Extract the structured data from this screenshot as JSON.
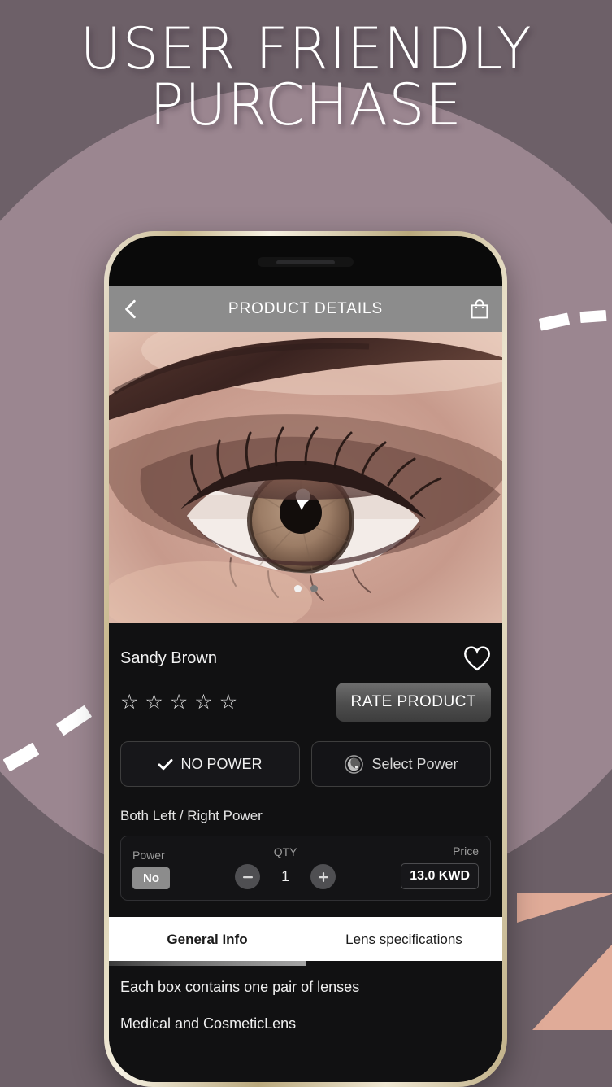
{
  "headline": {
    "line1": "USER FRIENDLY",
    "line2": "PURCHASE"
  },
  "colors": {
    "background": "#6d6068",
    "circle": "#9b8690",
    "triangle": "#e0ab98",
    "appbar": "#8c8c8c",
    "screen": "#111112",
    "pill": "#8c8c8c"
  },
  "phone": {
    "appbar": {
      "title": "PRODUCT DETAILS",
      "back_icon": "chevron-left-icon",
      "cart_icon": "shopping-bag-icon"
    },
    "carousel": {
      "dots": 2,
      "active_index": 0,
      "image_alt": "Close-up of eye wearing sandy brown contact lens"
    },
    "product": {
      "name": "Sandy Brown",
      "favorite_icon": "heart-outline-icon",
      "rating": 0,
      "stars_total": 5,
      "rate_button": "RATE PRODUCT"
    },
    "power_options": [
      {
        "label": "NO POWER",
        "icon": "check-icon",
        "selected": true
      },
      {
        "label": "Select Power",
        "icon": "lens-icon",
        "selected": false
      }
    ],
    "both_power_label": "Both Left / Right Power",
    "purchase_row": {
      "power_header": "Power",
      "power_value": "No",
      "qty_header": "QTY",
      "qty_value": "1",
      "decrease_icon": "minus-circle-icon",
      "increase_icon": "plus-circle-icon",
      "price_header": "Price",
      "price_value": "13.0 KWD"
    },
    "tabs": [
      {
        "label": "General Info",
        "active": true
      },
      {
        "label": "Lens specifications",
        "active": false
      }
    ],
    "description": [
      "Each box contains one pair of lenses",
      "Medical and CosmeticLens"
    ]
  }
}
